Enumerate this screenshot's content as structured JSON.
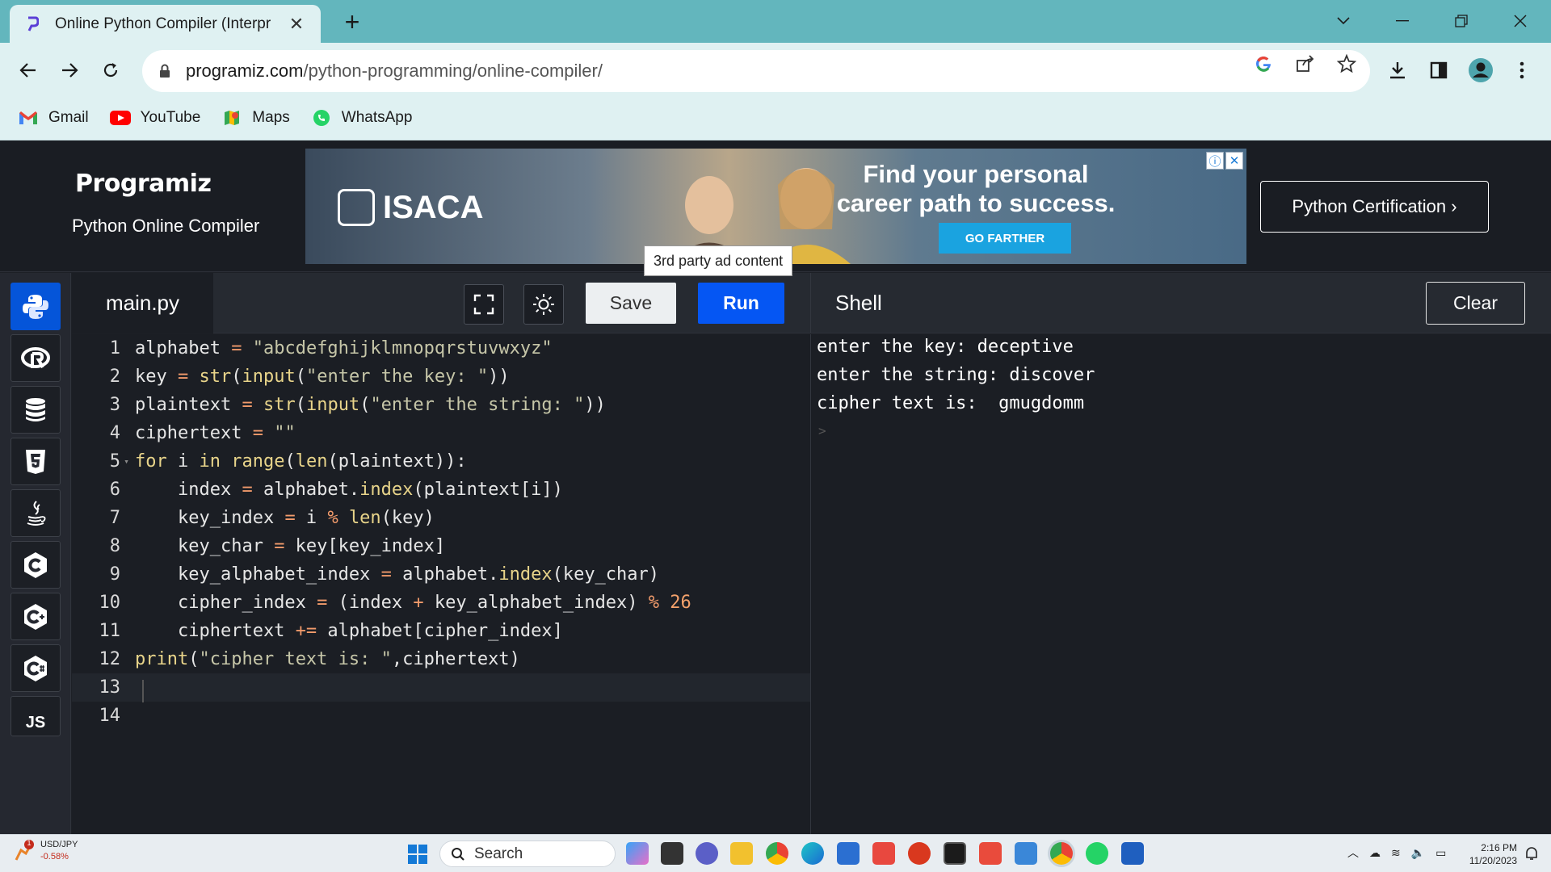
{
  "browser": {
    "tab": {
      "title": "Online Python Compiler (Interpr",
      "close": "✕"
    },
    "new_tab": "+",
    "url": {
      "host": "programiz.com",
      "path": "/python-programming/online-compiler/"
    },
    "bookmarks": [
      {
        "label": "Gmail",
        "icon": "gmail-icon"
      },
      {
        "label": "YouTube",
        "icon": "youtube-icon"
      },
      {
        "label": "Maps",
        "icon": "maps-icon"
      },
      {
        "label": "WhatsApp",
        "icon": "whatsapp-icon"
      }
    ]
  },
  "header": {
    "logo": "Programiz",
    "subtitle": "Python Online Compiler",
    "ad": {
      "brand": "ISACA",
      "headline": "Find your personal career path to success.",
      "cta": "GO FARTHER",
      "tooltip": "3rd party ad content"
    },
    "certification_button": "Python Certification ›"
  },
  "sidebar": {
    "languages": [
      {
        "name": "python",
        "icon": "python-icon",
        "active": true
      },
      {
        "name": "r",
        "icon": "r-icon"
      },
      {
        "name": "sql",
        "icon": "database-icon"
      },
      {
        "name": "html",
        "icon": "html5-icon"
      },
      {
        "name": "java",
        "icon": "java-icon"
      },
      {
        "name": "c",
        "icon": "c-icon"
      },
      {
        "name": "cpp",
        "icon": "cpp-icon"
      },
      {
        "name": "csharp",
        "icon": "csharp-icon"
      },
      {
        "name": "js",
        "label": "JS",
        "icon": "js-icon"
      }
    ]
  },
  "editor": {
    "filename": "main.py",
    "save_label": "Save",
    "run_label": "Run",
    "lines": [
      "alphabet = \"abcdefghijklmnopqrstuvwxyz\"",
      "key = str(input(\"enter the key: \"))",
      "plaintext = str(input(\"enter the string: \"))",
      "ciphertext = \"\"",
      "for i in range(len(plaintext)):",
      "    index = alphabet.index(plaintext[i])",
      "    key_index = i % len(key)",
      "    key_char = key[key_index]",
      "    key_alphabet_index = alphabet.index(key_char)",
      "    cipher_index = (index + key_alphabet_index) % 26",
      "    ciphertext += alphabet[cipher_index]",
      "print(\"cipher text is: \",ciphertext)",
      "",
      ""
    ],
    "line_numbers": [
      "1",
      "2",
      "3",
      "4",
      "5",
      "6",
      "7",
      "8",
      "9",
      "10",
      "11",
      "12",
      "13",
      "14"
    ]
  },
  "shell": {
    "title": "Shell",
    "clear_label": "Clear",
    "output": [
      "enter the key: deceptive",
      "enter the string: discover",
      "cipher text is:  gmugdomm"
    ],
    "prompt": ">"
  },
  "taskbar": {
    "ticker": {
      "symbol": "USD/JPY",
      "change": "-0.58%",
      "badge": "1"
    },
    "search_placeholder": "Search",
    "time": "2:16 PM",
    "date": "11/20/2023"
  }
}
